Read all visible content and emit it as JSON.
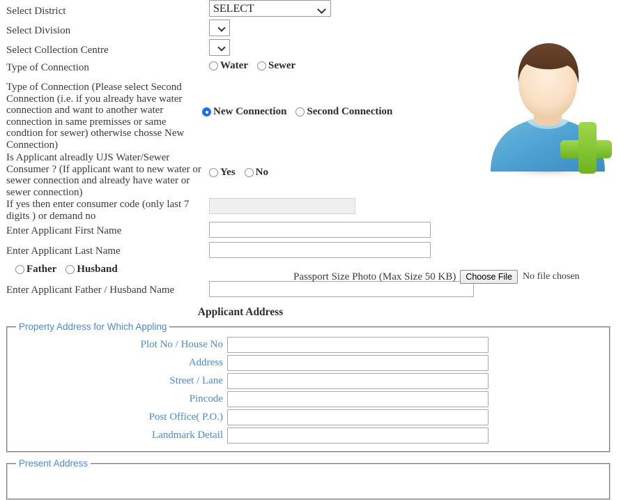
{
  "form": {
    "rows": [
      {
        "label": "Select District",
        "control": "select-district"
      },
      {
        "label": "Select Division",
        "control": "select-division"
      },
      {
        "label": "Select Collection Centre",
        "control": "select-centre"
      },
      {
        "label": "Type of Connection",
        "control": "radio-type"
      },
      {
        "label": "Type of Connection (Please select Second Connection (i.e. if you already have water connection and want to another water connection in same premisses or same condtion for sewer) otherwise chosse New Connection)",
        "control": "radio-connection"
      },
      {
        "label": "Is Applicant alreadly UJS Water/Sewer Consumer ? (If applicant want to new water or sewer connection and already have water or sewer connection)",
        "control": "radio-ujs"
      },
      {
        "label": "If yes then enter consumer code (only last 7 digits ) or demand no",
        "control": "input-code"
      },
      {
        "label": "Enter Applicant First Name",
        "control": "input-first"
      },
      {
        "label": "Enter Applicant Last Name",
        "control": "input-last"
      },
      {
        "label": "Enter Applicant Father / Husband Name",
        "control": "input-fh"
      }
    ],
    "district_select": {
      "selected": "SELECT",
      "options": [
        "SELECT"
      ]
    },
    "division_select": {
      "selected": "",
      "options": [
        ""
      ]
    },
    "centre_select": {
      "selected": "",
      "options": [
        ""
      ]
    },
    "connection_type_radios": [
      {
        "label": "Water",
        "checked": false
      },
      {
        "label": "Sewer",
        "checked": false
      }
    ],
    "connection_kind_radios": [
      {
        "label": "New Connection",
        "checked": true
      },
      {
        "label": "Second Connection",
        "checked": false
      }
    ],
    "ujs_consumer_radios": [
      {
        "label": "Yes",
        "checked": false
      },
      {
        "label": "No",
        "checked": false
      }
    ],
    "relation_radios": [
      {
        "label": "Father",
        "checked": false
      },
      {
        "label": "Husband",
        "checked": false
      }
    ],
    "inputs": {
      "consumer_code": {
        "value": "",
        "placeholder": "",
        "disabled": true
      },
      "first_name": {
        "value": "",
        "placeholder": ""
      },
      "last_name": {
        "value": "",
        "placeholder": ""
      },
      "father_husband_name": {
        "value": "",
        "placeholder": ""
      }
    },
    "photo_upload": {
      "caption": "Passport Size Photo (Max Size 50 KB)",
      "button_label": "Choose File",
      "status": "No file chosen"
    }
  },
  "address": {
    "section_title": "Applicant Address",
    "property_fieldset": {
      "legend": "Property Address for Which Appling",
      "fields": [
        {
          "label": "Plot No / House No",
          "value": ""
        },
        {
          "label": "Address",
          "value": ""
        },
        {
          "label": "Street / Lane",
          "value": ""
        },
        {
          "label": "Pincode",
          "value": ""
        },
        {
          "label": "Post Office( P.O.)",
          "value": ""
        },
        {
          "label": "Landmark Detail",
          "value": ""
        }
      ]
    },
    "present_fieldset": {
      "legend": "Present Address",
      "fields": []
    }
  },
  "icons": {
    "avatar": "add-user-icon",
    "dropdown": "chevron-down-icon"
  },
  "colors": {
    "label_text": "#3a3a3a",
    "accent_blue": "#4a89dc",
    "radio_checked": "#1a73e8",
    "avatar_shirt": "#4a9fd0",
    "avatar_hair": "#5c3a24",
    "avatar_plus": "#7cc02e",
    "input_border": "#a9a9a9",
    "disabled_bg": "#efefef"
  }
}
